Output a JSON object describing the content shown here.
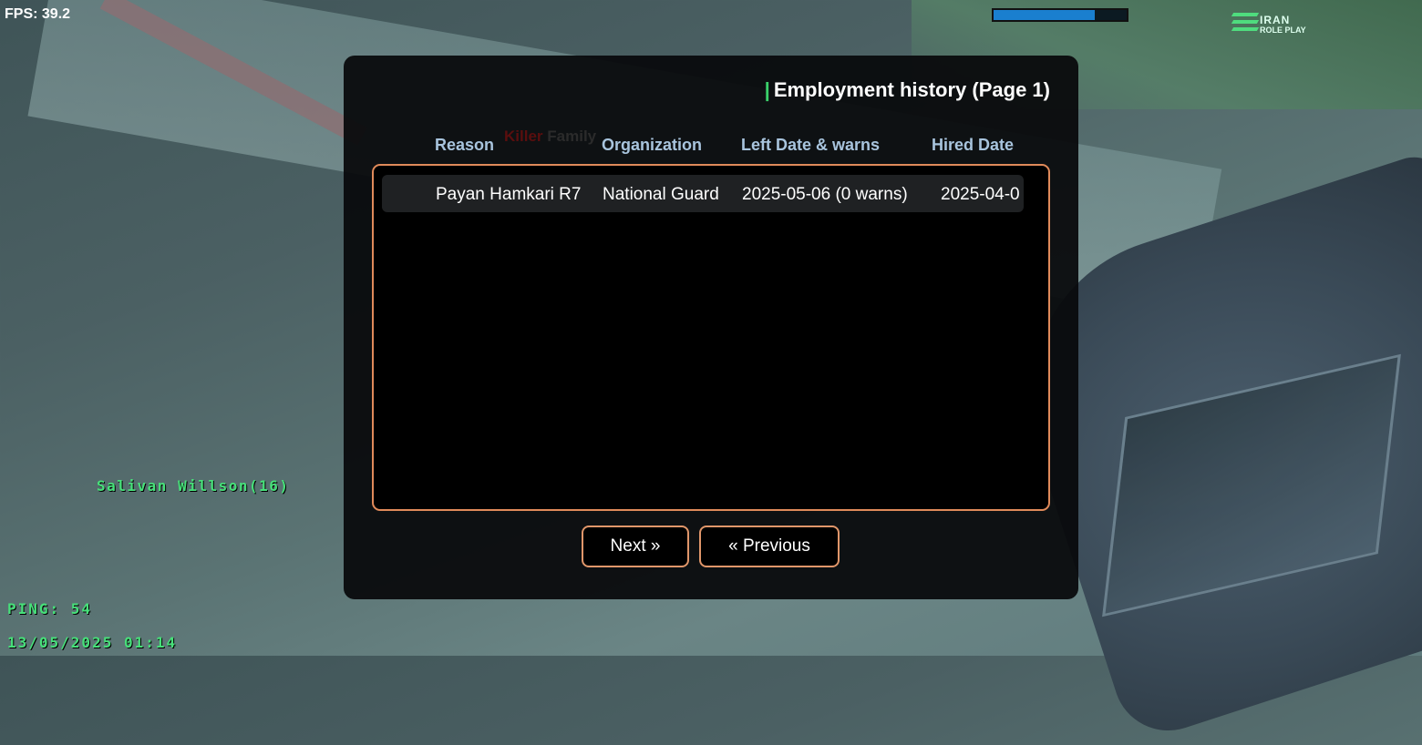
{
  "hud": {
    "fps": "FPS: 39.2",
    "health_fraction": 0.76,
    "logo_line1": "IRAN",
    "logo_line2": "ROLE PLAY",
    "player_name": "Salivan Willson(16)",
    "ping": "PING: 54",
    "datetime": "13/05/2025 01:14"
  },
  "background_tag": {
    "part1": "Killer",
    "part2": "Family"
  },
  "dialog": {
    "title_mark": "|",
    "title": "Employment history (Page 1)",
    "columns": [
      "Reason",
      "Organization",
      "Left Date & warns",
      "Hired Date"
    ],
    "rows": [
      {
        "reason": "Payan Hamkari R7",
        "organization": "National Guard",
        "left": "2025-05-06 (0 warns)",
        "hired": "2025-04-0"
      }
    ],
    "next_label": "Next »",
    "prev_label": "« Previous"
  },
  "colors": {
    "accent_border": "#e08a5a",
    "header_text": "#a8c4dd",
    "hud_green": "#47e07a",
    "title_mark": "#3ad06a"
  }
}
